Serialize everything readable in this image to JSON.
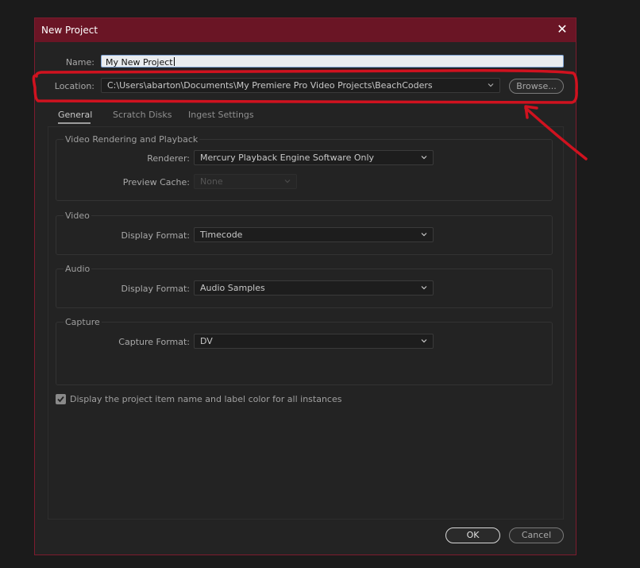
{
  "dialog": {
    "title": "New Project",
    "close_icon": "close-icon"
  },
  "name_field": {
    "label": "Name:",
    "value": "My New Project"
  },
  "location_field": {
    "label": "Location:",
    "value": "C:\\Users\\abarton\\Documents\\My Premiere Pro Video Projects\\BeachCoders",
    "browse_label": "Browse..."
  },
  "tabs": [
    {
      "label": "General",
      "active": true
    },
    {
      "label": "Scratch Disks",
      "active": false
    },
    {
      "label": "Ingest Settings",
      "active": false
    }
  ],
  "groups": {
    "video_rendering": {
      "title": "Video Rendering and Playback",
      "renderer_label": "Renderer:",
      "renderer_value": "Mercury Playback Engine Software Only",
      "preview_cache_label": "Preview Cache:",
      "preview_cache_value": "None"
    },
    "video": {
      "title": "Video",
      "display_format_label": "Display Format:",
      "display_format_value": "Timecode"
    },
    "audio": {
      "title": "Audio",
      "display_format_label": "Display Format:",
      "display_format_value": "Audio Samples"
    },
    "capture": {
      "title": "Capture",
      "capture_format_label": "Capture Format:",
      "capture_format_value": "DV"
    }
  },
  "checkbox": {
    "label": "Display the project item name and label color for all instances",
    "checked": true
  },
  "buttons": {
    "ok": "OK",
    "cancel": "Cancel"
  },
  "colors": {
    "title_bar": "#6a1525",
    "dialog_border": "#7d1b2e",
    "annotation_red": "#d0121f",
    "background": "#232323"
  }
}
